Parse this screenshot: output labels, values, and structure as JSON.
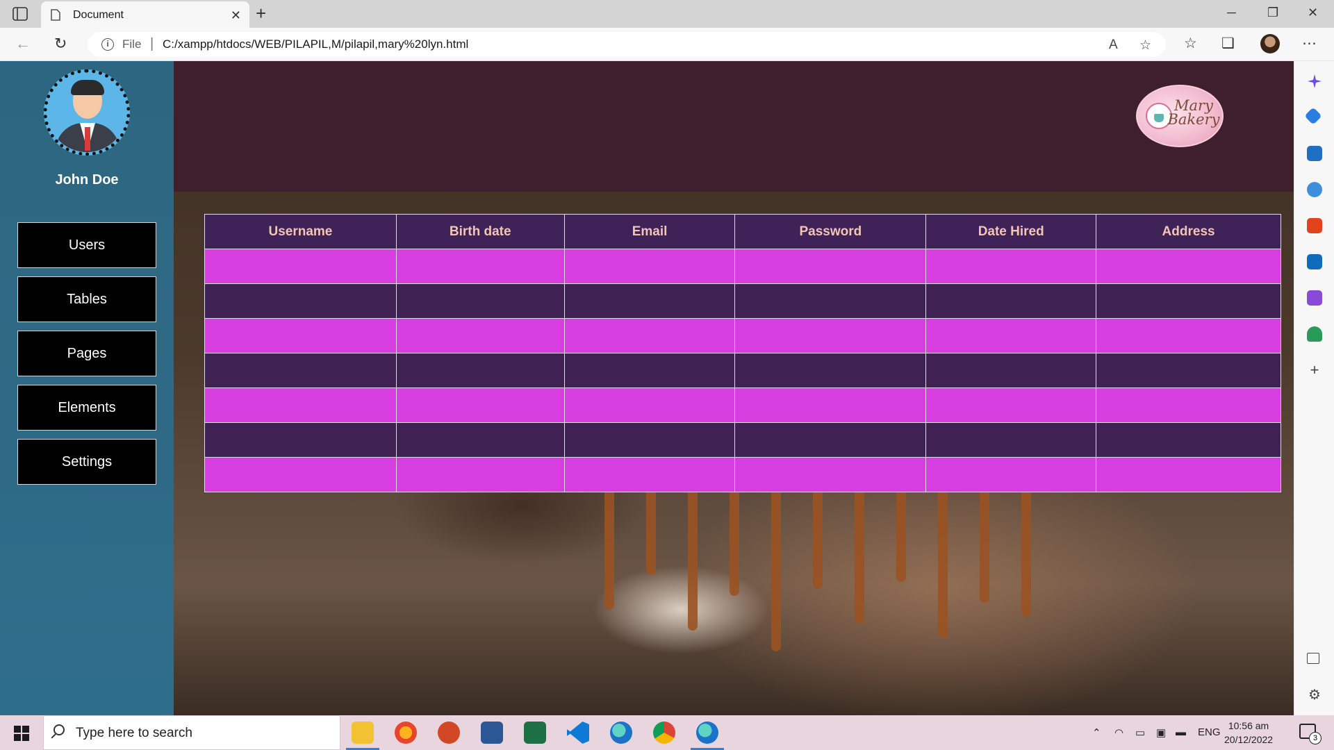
{
  "browser": {
    "tab_title": "Document",
    "new_tab_symbol": "+",
    "file_label": "File",
    "url": "C:/xampp/htdocs/WEB/PILAPIL,M/pilapil,mary%20lyn.html"
  },
  "sidebar": {
    "user_name": "John Doe",
    "items": [
      {
        "label": "Users"
      },
      {
        "label": "Tables"
      },
      {
        "label": "Pages"
      },
      {
        "label": "Elements"
      },
      {
        "label": "Settings"
      }
    ]
  },
  "header": {
    "logo_text": "Mary Bakery"
  },
  "table": {
    "columns": [
      "Username",
      "Birth date",
      "Email",
      "Password",
      "Date Hired",
      "Address"
    ],
    "row_count": 7
  },
  "taskbar": {
    "search_placeholder": "Type here to search",
    "language": "ENG",
    "time": "10:56 am",
    "date": "20/12/2022",
    "notification_count": "3"
  },
  "colors": {
    "sidebar": "#2e6a86",
    "header": "#3f1f2e",
    "row_magenta": "#d63ee0",
    "row_purple": "#3f2056",
    "header_text": "#f2c6b4"
  }
}
